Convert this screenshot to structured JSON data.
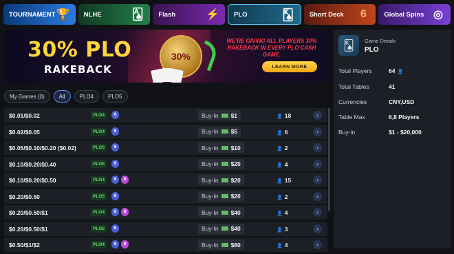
{
  "tabs": [
    {
      "label": "TOURNAMENT",
      "icon": "trophy-icon",
      "glyph": "🏆"
    },
    {
      "label": "NLHE",
      "icon": "cards-icon",
      "glyph": "🂡"
    },
    {
      "label": "Flash",
      "icon": "lightning-icon",
      "glyph": "⚡"
    },
    {
      "label": "PLO",
      "icon": "cards-fan-icon",
      "glyph": "🂮"
    },
    {
      "label": "Short Deck",
      "icon": "number-six-icon",
      "glyph": "6"
    },
    {
      "label": "Global Spins",
      "icon": "spin-icon",
      "glyph": "◎"
    }
  ],
  "banner": {
    "headline": "30% PLO",
    "subline": "RAKEBACK",
    "coin_text": "30%",
    "message": "WE'RE GIVING ALL PLAYERS 30% RAKEBACK IN EVERY PLO CASH GAME.",
    "cta": "LEARN MORE"
  },
  "filters": {
    "my_games": "My Games (0)",
    "all": "All",
    "plo4": "PLO4",
    "plo5": "PLO5"
  },
  "buyin_label": "Buy-In",
  "rows": [
    {
      "stakes": "$0.01/$0.02",
      "game": "PLO4",
      "seats": "6",
      "max": "",
      "buyin": "$1",
      "players": "18"
    },
    {
      "stakes": "$0.02/$0.05",
      "game": "PLO4",
      "seats": "6",
      "max": "",
      "buyin": "$5",
      "players": "6"
    },
    {
      "stakes": "$0.05/$0.10/$0.20 ($0.02)",
      "game": "PLO5",
      "seats": "6",
      "max": "",
      "buyin": "$10",
      "players": "2"
    },
    {
      "stakes": "$0.10/$0.20/$0.40",
      "game": "PLO5",
      "seats": "6",
      "max": "",
      "buyin": "$20",
      "players": "4"
    },
    {
      "stakes": "$0.10/$0.20/$0.50",
      "game": "PLO4",
      "seats": "6",
      "max": "8",
      "buyin": "$20",
      "players": "15"
    },
    {
      "stakes": "$0.20/$0.50",
      "game": "PLO5",
      "seats": "6",
      "max": "",
      "buyin": "$20",
      "players": "2"
    },
    {
      "stakes": "$0.20/$0.50/$1",
      "game": "PLO4",
      "seats": "6",
      "max": "8",
      "buyin": "$40",
      "players": "4"
    },
    {
      "stakes": "$0.20/$0.50/$1",
      "game": "PLO5",
      "seats": "6",
      "max": "",
      "buyin": "$40",
      "players": "3"
    },
    {
      "stakes": "$0.50/$1/$2",
      "game": "PLO4",
      "seats": "6",
      "max": "8",
      "buyin": "$80",
      "players": "4"
    }
  ],
  "details": {
    "label": "Game Details",
    "name": "PLO",
    "items": [
      {
        "key": "Total Players",
        "value": "64"
      },
      {
        "key": "Total Tables",
        "value": "41"
      },
      {
        "key": "Currencies",
        "value": "CNY,USD"
      },
      {
        "key": "Table Max",
        "value": "6,8 Players"
      },
      {
        "key": "Buy-in",
        "value": "$1 - $20,000"
      }
    ]
  }
}
